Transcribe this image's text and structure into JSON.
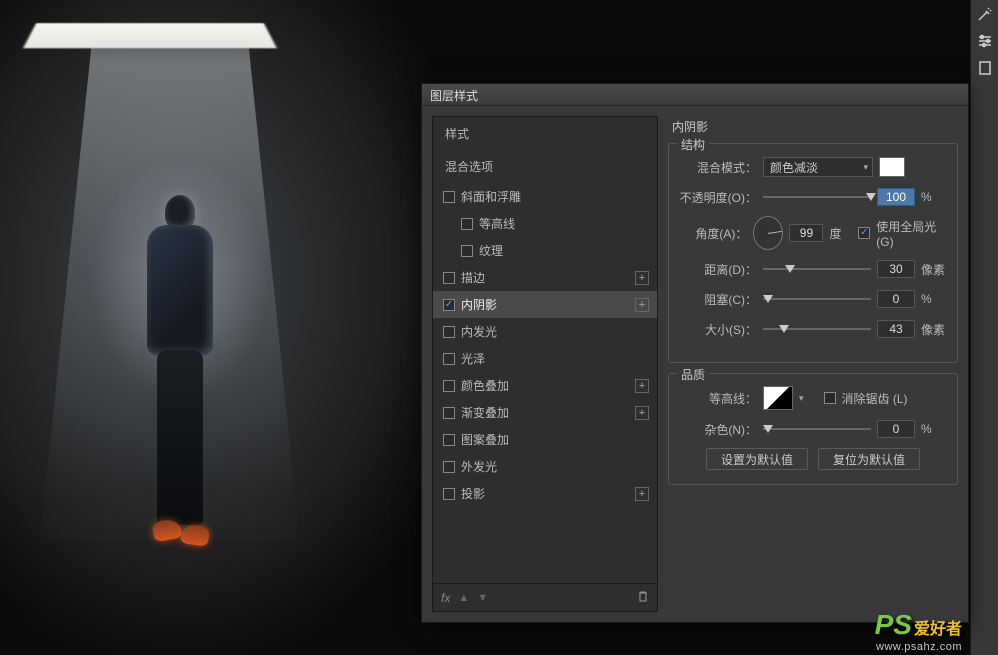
{
  "dialog": {
    "title": "图层样式",
    "left": {
      "header": "样式",
      "blend_options": "混合选项",
      "items": [
        {
          "label": "斜面和浮雕",
          "checked": false,
          "plus": false,
          "indent": false
        },
        {
          "label": "等高线",
          "checked": false,
          "plus": false,
          "indent": true
        },
        {
          "label": "纹理",
          "checked": false,
          "plus": false,
          "indent": true
        },
        {
          "label": "描边",
          "checked": false,
          "plus": true,
          "indent": false
        },
        {
          "label": "内阴影",
          "checked": true,
          "plus": true,
          "indent": false,
          "active": true
        },
        {
          "label": "内发光",
          "checked": false,
          "plus": false,
          "indent": false
        },
        {
          "label": "光泽",
          "checked": false,
          "plus": false,
          "indent": false
        },
        {
          "label": "颜色叠加",
          "checked": false,
          "plus": true,
          "indent": false
        },
        {
          "label": "渐变叠加",
          "checked": false,
          "plus": true,
          "indent": false
        },
        {
          "label": "图案叠加",
          "checked": false,
          "plus": false,
          "indent": false
        },
        {
          "label": "外发光",
          "checked": false,
          "plus": false,
          "indent": false
        },
        {
          "label": "投影",
          "checked": false,
          "plus": true,
          "indent": false
        }
      ],
      "fx": "fx"
    },
    "right": {
      "title": "内阴影",
      "structure": {
        "legend": "结构",
        "blend_mode_label": "混合模式：",
        "blend_mode_value": "颜色减淡",
        "opacity_label": "不透明度(O)：",
        "opacity_value": "100",
        "opacity_unit": "%",
        "angle_label": "角度(A)：",
        "angle_value": "99",
        "angle_unit": "度",
        "global_light": "使用全局光 (G)",
        "distance_label": "距离(D)：",
        "distance_value": "30",
        "distance_unit": "像素",
        "choke_label": "阻塞(C)：",
        "choke_value": "0",
        "choke_unit": "%",
        "size_label": "大小(S)：",
        "size_value": "43",
        "size_unit": "像素"
      },
      "quality": {
        "legend": "品质",
        "contour_label": "等高线：",
        "antialias": "消除锯齿 (L)",
        "noise_label": "杂色(N)：",
        "noise_value": "0",
        "noise_unit": "%"
      },
      "buttons": {
        "make_default": "设置为默认值",
        "reset_default": "复位为默认值"
      }
    }
  },
  "watermark": {
    "ps": "PS",
    "text": "爱好者",
    "url": "www.psahz.com"
  }
}
